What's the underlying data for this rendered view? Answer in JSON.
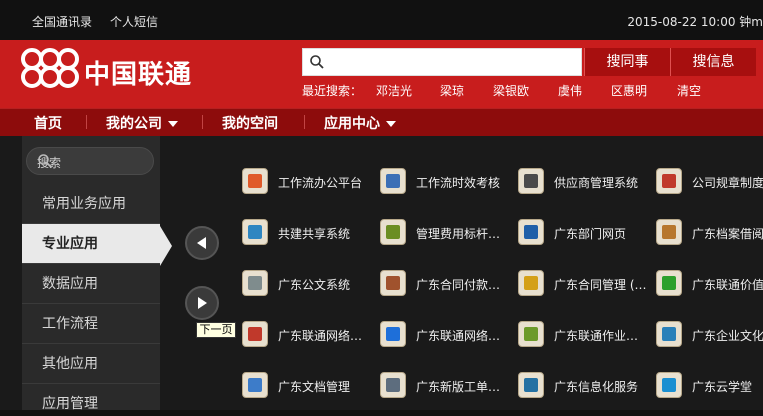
{
  "topbar": {
    "links": [
      "全国通讯录",
      "个人短信"
    ],
    "datetime": "2015-08-22 10:00 钟m"
  },
  "brand": {
    "name": "中国联通"
  },
  "search": {
    "placeholder": "",
    "buttons": [
      "搜同事",
      "搜信息"
    ],
    "recent_label": "最近搜索：",
    "recent": [
      "邓洁光",
      "梁琼",
      "梁银欧",
      "虞伟",
      "区惠明",
      "清空"
    ]
  },
  "nav": {
    "items": [
      {
        "label": "首页",
        "dropdown": false
      },
      {
        "label": "我的公司",
        "dropdown": true
      },
      {
        "label": "我的空间",
        "dropdown": false
      },
      {
        "label": "应用中心",
        "dropdown": true
      }
    ]
  },
  "sidebar": {
    "search_label": "搜索",
    "items": [
      {
        "label": "常用业务应用",
        "active": false
      },
      {
        "label": "专业应用",
        "active": true
      },
      {
        "label": "数据应用",
        "active": false
      },
      {
        "label": "工作流程",
        "active": false
      },
      {
        "label": "其他应用",
        "active": false
      },
      {
        "label": "应用管理",
        "active": false
      }
    ]
  },
  "pager": {
    "tooltip": "下一页"
  },
  "apps": [
    {
      "label": "工作流办公平台",
      "icon": "workflow-icon",
      "color": "#e05a2a"
    },
    {
      "label": "工作流时效考核",
      "icon": "clock-user-icon",
      "color": "#3b6fb6"
    },
    {
      "label": "供应商管理系统",
      "icon": "person-icon",
      "color": "#4a4a4a"
    },
    {
      "label": "公司规章制度",
      "icon": "pin-document-icon",
      "color": "#c0392b"
    },
    {
      "label": "共建共享系统",
      "icon": "share-icon",
      "color": "#2e86c1"
    },
    {
      "label": "管理费用标杆…",
      "icon": "finance-icon",
      "color": "#6b8e23"
    },
    {
      "label": "广东部门网页",
      "icon": "webpage-icon",
      "color": "#1f5fa8"
    },
    {
      "label": "广东档案借阅",
      "icon": "archive-icon",
      "color": "#b7772e"
    },
    {
      "label": "广东公文系统",
      "icon": "document-icon",
      "color": "#7f8c8d"
    },
    {
      "label": "广东合同付款…",
      "icon": "contract-icon",
      "color": "#a0522d"
    },
    {
      "label": "广东合同管理 (…",
      "icon": "folder-icon",
      "color": "#d4a017"
    },
    {
      "label": "广东联通价值",
      "icon": "browser-icon",
      "color": "#2ca02c"
    },
    {
      "label": "广东联通网络…",
      "icon": "window-icon",
      "color": "#c0392b"
    },
    {
      "label": "广东联通网络…",
      "icon": "ie-icon",
      "color": "#1e6fd9"
    },
    {
      "label": "广东联通作业…",
      "icon": "settings-doc-icon",
      "color": "#6c9a2a"
    },
    {
      "label": "广东企业文化",
      "icon": "culture-icon",
      "color": "#2980b9"
    },
    {
      "label": "广东文档管理",
      "icon": "docs-icon",
      "color": "#3d7cc9"
    },
    {
      "label": "广东新版工单…",
      "icon": "ticket-icon",
      "color": "#5d6d7e"
    },
    {
      "label": "广东信息化服务",
      "icon": "service-icon",
      "color": "#2471a3"
    },
    {
      "label": "广东云学堂",
      "icon": "cloud-icon",
      "color": "#1a8fd1"
    }
  ]
}
